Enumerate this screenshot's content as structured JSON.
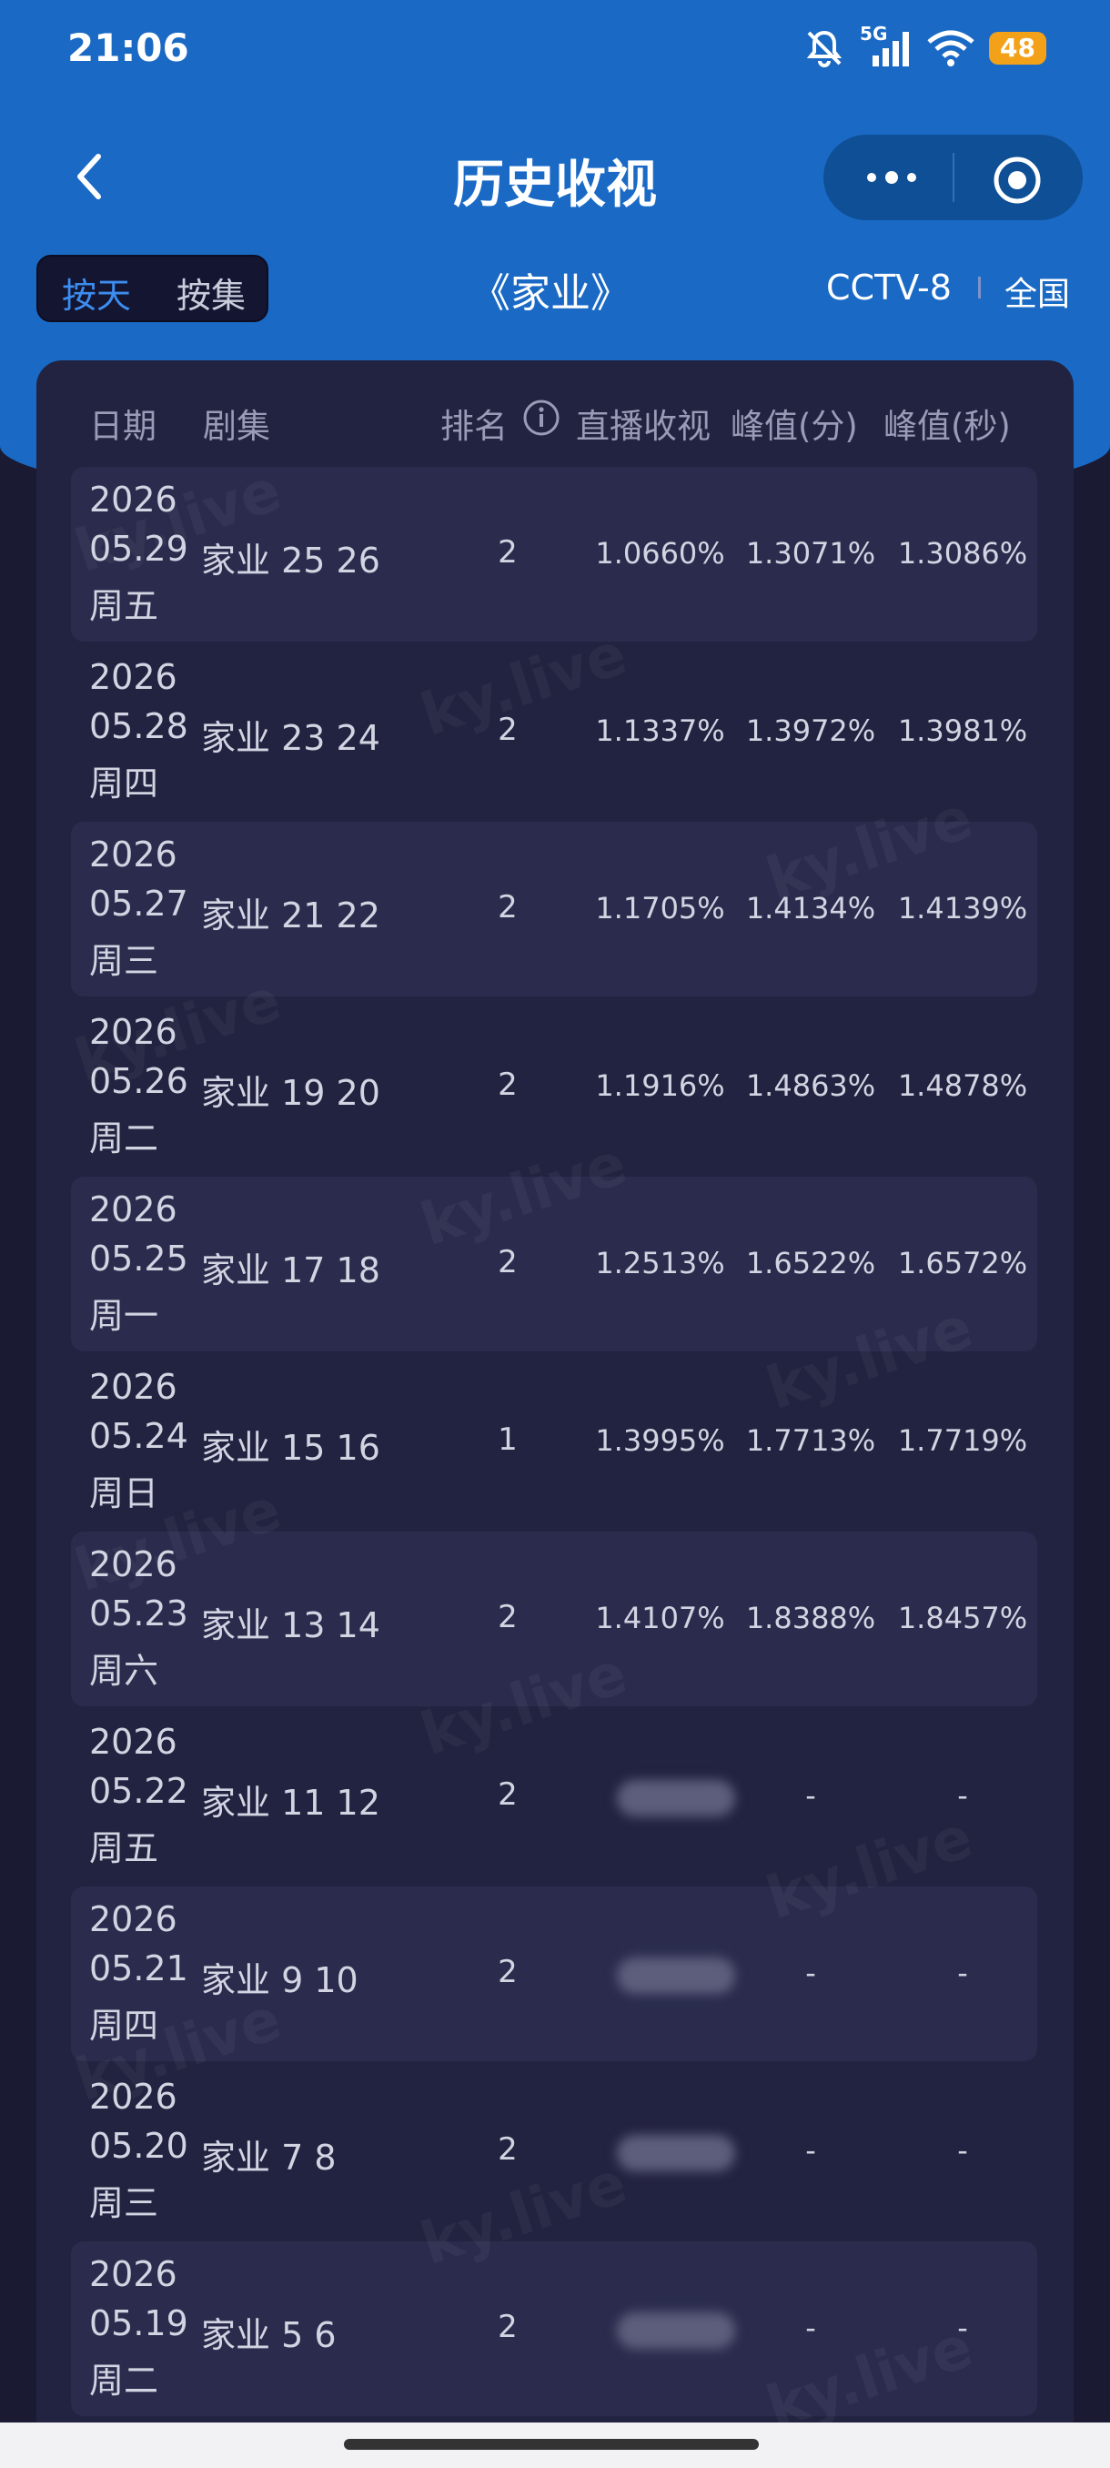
{
  "status_bar": {
    "time": "21:06",
    "network": "5G",
    "battery": "48",
    "icons": [
      "mute-bell-icon",
      "signal-icon",
      "wifi-icon",
      "battery-icon"
    ]
  },
  "nav": {
    "title": "历史收视",
    "back_icon": "chevron-left-icon",
    "more_icon": "more-dots-icon",
    "target_icon": "target-icon"
  },
  "filters": {
    "mode_options": [
      "按天",
      "按集"
    ],
    "active_mode": "按天",
    "drama_title": "《家业》",
    "channel": "CCTV-8",
    "region": "全国"
  },
  "table": {
    "headers": {
      "date": "日期",
      "episode": "剧集",
      "rank": "排名",
      "live": "直播收视",
      "peak_min": "峰值(分)",
      "peak_sec": "峰值(秒)"
    },
    "rows": [
      {
        "year": "2026",
        "date": "05.29",
        "weekday": "周五",
        "episode": "家业 25 26",
        "rank": "2",
        "live": "1.0660%",
        "peak_min": "1.3071%",
        "peak_sec": "1.3086%"
      },
      {
        "year": "2026",
        "date": "05.28",
        "weekday": "周四",
        "episode": "家业 23 24",
        "rank": "2",
        "live": "1.1337%",
        "peak_min": "1.3972%",
        "peak_sec": "1.3981%"
      },
      {
        "year": "2026",
        "date": "05.27",
        "weekday": "周三",
        "episode": "家业 21 22",
        "rank": "2",
        "live": "1.1705%",
        "peak_min": "1.4134%",
        "peak_sec": "1.4139%"
      },
      {
        "year": "2026",
        "date": "05.26",
        "weekday": "周二",
        "episode": "家业 19 20",
        "rank": "2",
        "live": "1.1916%",
        "peak_min": "1.4863%",
        "peak_sec": "1.4878%"
      },
      {
        "year": "2026",
        "date": "05.25",
        "weekday": "周一",
        "episode": "家业 17 18",
        "rank": "2",
        "live": "1.2513%",
        "peak_min": "1.6522%",
        "peak_sec": "1.6572%"
      },
      {
        "year": "2026",
        "date": "05.24",
        "weekday": "周日",
        "episode": "家业 15 16",
        "rank": "1",
        "live": "1.3995%",
        "peak_min": "1.7713%",
        "peak_sec": "1.7719%"
      },
      {
        "year": "2026",
        "date": "05.23",
        "weekday": "周六",
        "episode": "家业 13 14",
        "rank": "2",
        "live": "1.4107%",
        "peak_min": "1.8388%",
        "peak_sec": "1.8457%"
      },
      {
        "year": "2026",
        "date": "05.22",
        "weekday": "周五",
        "episode": "家业 11 12",
        "rank": "2",
        "live": "",
        "peak_min": "-",
        "peak_sec": "-"
      },
      {
        "year": "2026",
        "date": "05.21",
        "weekday": "周四",
        "episode": "家业 9 10",
        "rank": "2",
        "live": "",
        "peak_min": "-",
        "peak_sec": "-"
      },
      {
        "year": "2026",
        "date": "05.20",
        "weekday": "周三",
        "episode": "家业 7 8",
        "rank": "2",
        "live": "",
        "peak_min": "-",
        "peak_sec": "-"
      },
      {
        "year": "2026",
        "date": "05.19",
        "weekday": "周二",
        "episode": "家业 5 6",
        "rank": "2",
        "live": "",
        "peak_min": "-",
        "peak_sec": "-"
      }
    ]
  },
  "watermark": "ky.live",
  "colors": {
    "header_blue": "#1a6ac5",
    "page_bg": "#1a1b33",
    "card_bg": "#222340",
    "row_alt": "#2b2c4d",
    "accent": "#3c8df0",
    "battery": "#f4a11a"
  }
}
